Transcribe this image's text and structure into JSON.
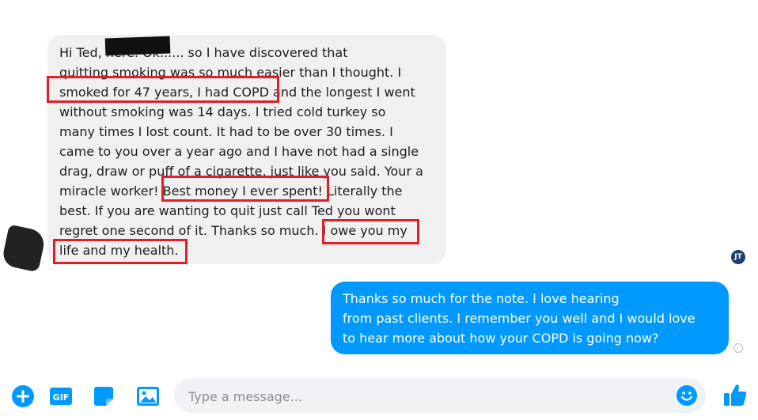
{
  "conversation": {
    "incoming_message": "Hi Ted,              here.  Ok...... so I have discovered that\nquitting smoking was so much easier than I thought.  I\nsmoked for 47 years, I had COPD and the longest I went\nwithout smoking was 14 days.  I tried cold turkey so\nmany times I lost count. It had to be over 30 times. I\ncame to you over a year ago and I have not had a single\ndrag, draw or puff of a cigarette, just like you said. Your a\nmiracle worker! Best money I ever spent! Literally the\nbest. If you are wanting to quit just call Ted you wont\nregret one second of it. Thanks so much. I owe you my\nlife and my health.",
    "outgoing_message": "Thanks so much                   for the note. I love hearing\nfrom past clients. I remember you well and I would love\nto hear more about how your COPD is going now?",
    "seen_avatar_initials": "JT"
  },
  "composer": {
    "placeholder": "Type a message...",
    "gif_label": "GIF",
    "icons": [
      "plus-icon",
      "gif-icon",
      "sticker-icon",
      "image-icon",
      "emoji-icon",
      "thumbs-up-icon"
    ]
  },
  "colors": {
    "accent": "#0099ff",
    "incoming_bubble": "#f1f0f0",
    "highlight": "#e01f26"
  }
}
